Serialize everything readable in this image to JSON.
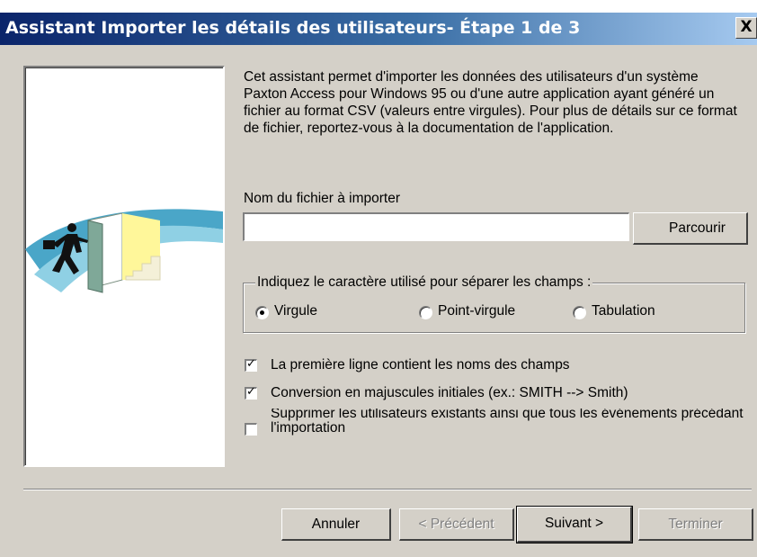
{
  "window": {
    "title": "Assistant Importer les détails des utilisateurs- Étape 1 de 3",
    "close_label": "X"
  },
  "intro": {
    "text": "Cet assistant permet d'importer les données des utilisateurs d'un système Paxton Access pour Windows 95 ou d'une autre application ayant généré un fichier au format CSV (valeurs entre virgules). Pour plus de détails sur ce format de fichier, reportez-vous à la documentation de l'application."
  },
  "file": {
    "label": "Nom du fichier à importer",
    "value": "",
    "browse_label": "Parcourir"
  },
  "separator": {
    "legend": "Indiquez le caractère utilisé pour séparer les champs :",
    "options": [
      {
        "label": "Virgule",
        "selected": true
      },
      {
        "label": "Point-virgule",
        "selected": false
      },
      {
        "label": "Tabulation",
        "selected": false
      }
    ]
  },
  "options": [
    {
      "label": "La première ligne contient les noms des champs",
      "checked": true
    },
    {
      "label": "Conversion en majuscules initiales (ex.: SMITH --> Smith)",
      "checked": true
    },
    {
      "label": "Supprimer les utilisateurs existants ainsi que tous les événements précédant l'importation",
      "checked": false
    }
  ],
  "footer": {
    "cancel_label": "Annuler",
    "previous_label": "< Précédent",
    "next_label": "Suivant >",
    "finish_label": "Terminer"
  },
  "icons": {
    "illustration": "man-running-through-door-illustration",
    "checkmark": "check-mark-icon"
  },
  "colors": {
    "titlebar_start": "#0a246a",
    "titlebar_end": "#a6caf0",
    "dialog_face": "#d4d0c8"
  }
}
